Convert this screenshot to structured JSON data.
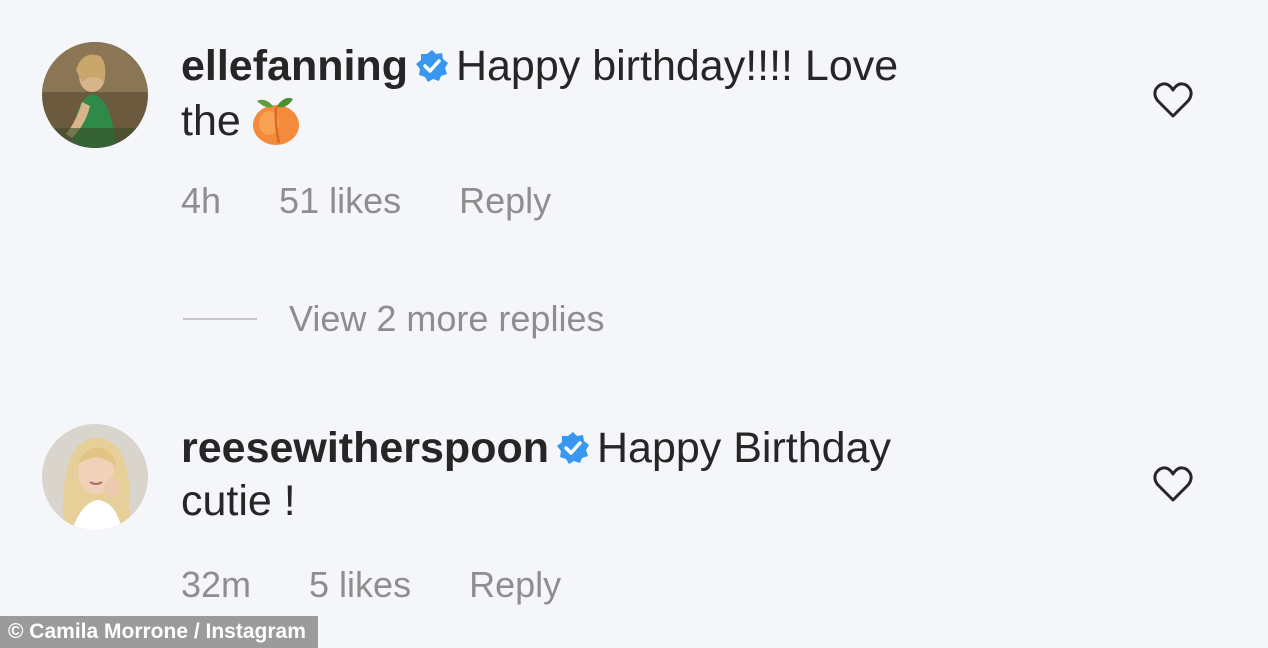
{
  "comments": [
    {
      "username": "ellefanning",
      "text_line1": "Happy birthday!!!! Love",
      "text_line2": "the",
      "emoji": "peach-emoji",
      "time": "4h",
      "likes": "51 likes",
      "reply": "Reply"
    },
    {
      "username": "reesewitherspoon",
      "text_line1": "Happy Birthday",
      "text_line2": "cutie !",
      "time": "32m",
      "likes": "5 likes",
      "reply": "Reply"
    }
  ],
  "view_replies": "View 2 more replies",
  "credit": "© Camila Morrone / Instagram",
  "colors": {
    "background": "#f5f6fa",
    "text": "#262626",
    "meta": "#8e8e8e",
    "verified": "#3897f0"
  }
}
